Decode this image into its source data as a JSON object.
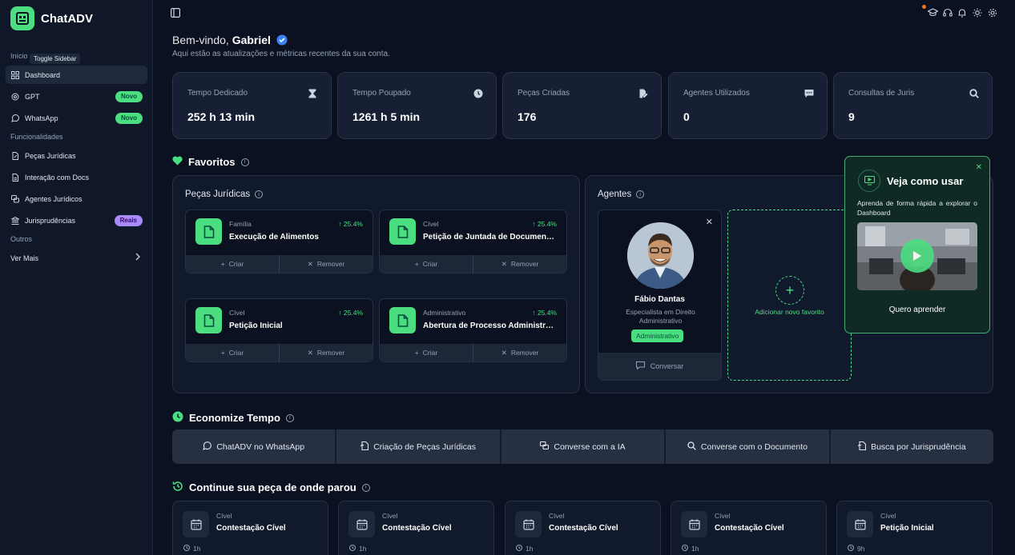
{
  "app": {
    "name": "ChatADV"
  },
  "tooltip": "Toggle Sidebar",
  "sidebar": {
    "sections": {
      "inicio": "Início",
      "funcionalidades": "Funcionalidades",
      "outros": "Outros"
    },
    "items": [
      {
        "label": "Dashboard"
      },
      {
        "label": "GPT",
        "badge": "Novo"
      },
      {
        "label": "WhatsApp",
        "badge": "Novo"
      },
      {
        "label": "Peças Jurídicas"
      },
      {
        "label": "Interação com Docs"
      },
      {
        "label": "Agentes Jurídicos"
      },
      {
        "label": "Jurisprudências",
        "badge": "Reais"
      },
      {
        "label": "Ver Mais"
      }
    ]
  },
  "header": {
    "welcome_prefix": "Bem-vindo,",
    "user_name": "Gabriel",
    "subtitle": "Aqui estão as atualizações e métricas recentes da sua conta."
  },
  "stats": [
    {
      "label": "Tempo Dedicado",
      "value": "252 h 13 min",
      "icon": "hourglass-icon"
    },
    {
      "label": "Tempo Poupado",
      "value": "1261 h 5 min",
      "icon": "clock-icon"
    },
    {
      "label": "Peças Criadas",
      "value": "176",
      "icon": "document-edit-icon"
    },
    {
      "label": "Agentes Utilizados",
      "value": "0",
      "icon": "chat-icon"
    },
    {
      "label": "Consultas de Juris",
      "value": "9",
      "icon": "search-icon"
    }
  ],
  "favorites": {
    "title": "Favoritos",
    "pieces_title": "Peças Jurídicas",
    "pieces": [
      {
        "category": "Família",
        "title": "Execução de Alimentos",
        "pct": "25.4%"
      },
      {
        "category": "Cível",
        "title": "Petição de Juntada de Documentos",
        "pct": "25.4%"
      },
      {
        "category": "Cível",
        "title": "Petição Inicial",
        "pct": "25.4%"
      },
      {
        "category": "Administrativo",
        "title": "Abertura de Processo Administrativo",
        "pct": "25.4%"
      }
    ],
    "create_label": "Criar",
    "remove_label": "Remover",
    "agents_title": "Agentes",
    "agent": {
      "name": "Fábio Dantas",
      "role": "Especialista em Direito Administrativo",
      "tag": "Administrativo",
      "action": "Conversar"
    },
    "add_label": "Adicionar novo favorito"
  },
  "popup": {
    "title": "Veja como usar",
    "text": "Aprenda de forma rápida a explorar o Dashboard",
    "cta": "Quero aprender"
  },
  "save_time": {
    "title": "Economize Tempo",
    "items": [
      {
        "label": "ChatADV no WhatsApp"
      },
      {
        "label": "Criação de Peças Jurídicas"
      },
      {
        "label": "Converse com a IA"
      },
      {
        "label": "Converse com o Documento"
      },
      {
        "label": "Busca por Jurisprudência"
      }
    ]
  },
  "continue": {
    "title": "Continue sua peça de onde parou",
    "items": [
      {
        "category": "Cível",
        "title": "Contestação Cível",
        "time": "1h"
      },
      {
        "category": "Cível",
        "title": "Contestação Cível",
        "time": "1h"
      },
      {
        "category": "Cível",
        "title": "Contestação Cível",
        "time": "1h"
      },
      {
        "category": "Cível",
        "title": "Contestação Cível",
        "time": "1h"
      },
      {
        "category": "Cível",
        "title": "Petição Inicial",
        "time": "9h"
      }
    ]
  },
  "colors": {
    "accent": "#4ade80",
    "background": "#0b1120",
    "badge_purple": "#a78bfa",
    "verified": "#3b82f6"
  }
}
